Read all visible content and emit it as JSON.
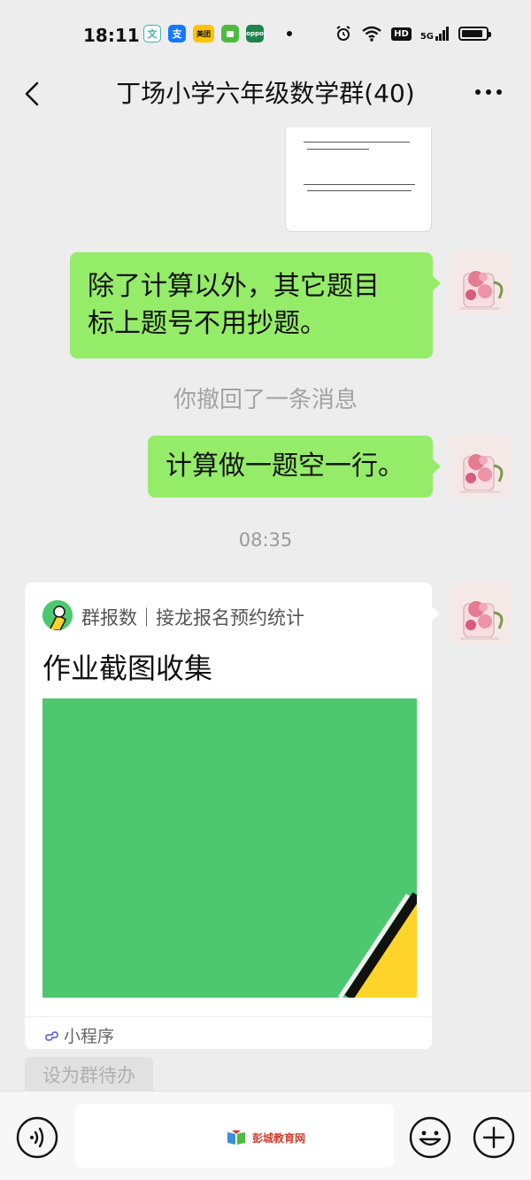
{
  "status_bar": {
    "time": "18:11",
    "app_icons": [
      {
        "name": "wen-app-icon",
        "glyph": "文",
        "color": "#3fb4a8"
      },
      {
        "name": "alipay-icon",
        "glyph": "支",
        "color": "#1677ff"
      },
      {
        "name": "meituan-icon",
        "glyph": "美团",
        "color": "#ffc300"
      },
      {
        "name": "app-green-icon",
        "glyph": "",
        "color": "#4cbb3f"
      },
      {
        "name": "oppo-icon",
        "glyph": "oppo",
        "color": "#1e8449"
      }
    ],
    "hd_label": "HD",
    "network_label": "5G"
  },
  "header": {
    "title": "丁场小学六年级数学群(40)"
  },
  "messages": {
    "bubble1": {
      "line1": "除了计算以外，其它题目",
      "line2": "标上题号不用抄题。"
    },
    "recall_notice": "你撤回了一条消息",
    "bubble2": "计算做一题空一行。",
    "timestamp": "08:35"
  },
  "mini_program": {
    "source": "群报数｜接龙报名预约统计",
    "title": "作业截图收集",
    "footer": "小程序"
  },
  "todo_button": "设为群待办",
  "input_bar": {
    "watermark": "彭城教育网"
  },
  "colors": {
    "background": "#ededed",
    "bubble_green": "#95ec69",
    "mini_green": "#4dc86f",
    "mini_yellow": "#ffd42a"
  }
}
